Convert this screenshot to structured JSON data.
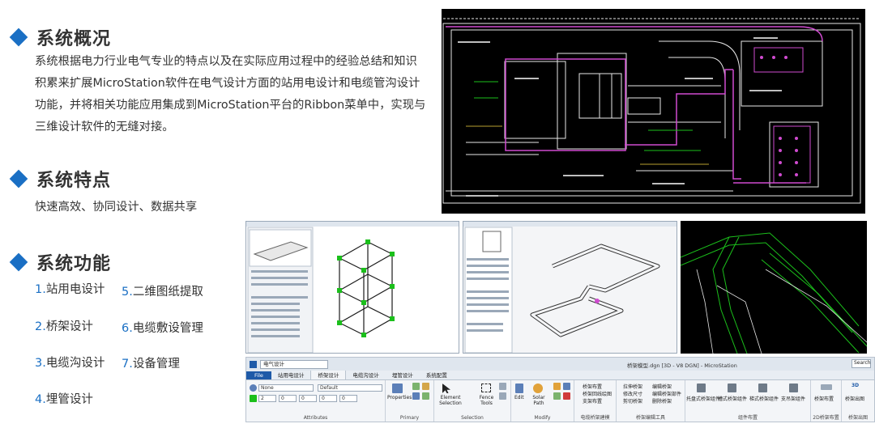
{
  "sections": {
    "overview": {
      "title": "系统概况",
      "lines": [
        "系统根据电力行业电气专业的特点以及在实际应用过程中的经验总结和知识",
        "积累来扩展MicroStation软件在电气设计方面的站用电设计和电缆管沟设计",
        "功能，并将相关功能应用集成到MicroStation平台的Ribbon菜单中，实现与",
        "三维设计软件的无缝对接。"
      ]
    },
    "features": {
      "title": "系统特点",
      "text": "快速高效、协同设计、数据共享"
    },
    "functions": {
      "title": "系统功能",
      "items": [
        {
          "num": "1.",
          "label": "站用电设计"
        },
        {
          "num": "5.",
          "label": "二维图纸提取"
        },
        {
          "num": "2.",
          "label": "桥架设计"
        },
        {
          "num": "6.",
          "label": "电缆敷设管理"
        },
        {
          "num": "3.",
          "label": "电缆沟设计"
        },
        {
          "num": "7.",
          "label": "设备管理"
        },
        {
          "num": "4.",
          "label": "埋管设计"
        }
      ]
    }
  },
  "colors": {
    "accent": "#1a6fc4",
    "cad_background": "#000000",
    "cad_lines": "#ffffff",
    "cad_highlight": "#d04bd0",
    "model_green": "#1bbf1b"
  },
  "ribbon": {
    "workspace": "电气设计",
    "document_title": "桥架模型.dgn [3D - V8 DGN] - MicroStation",
    "search_placeholder": "Search",
    "tabs": [
      "File",
      "站用电设计",
      "桥架设计",
      "电缆沟设计",
      "埋管设计",
      "系统配置"
    ],
    "active_tab": "桥架设计",
    "attributes": {
      "label": "Attributes",
      "level": "None",
      "style": "Default",
      "color": "2",
      "weight": "0",
      "weight2": "0",
      "line": "0",
      "trans": "0"
    },
    "primary": {
      "label": "Primary",
      "properties": "Properties"
    },
    "selection": {
      "label": "Selection",
      "element_selection": "Element Selection",
      "fence": "Fence Tools"
    },
    "modify": {
      "label": "Modify",
      "edit": "Edit",
      "solar": "Solar Path"
    },
    "cable_group": {
      "label": "电缆桥架建模",
      "items": [
        "桥架布置",
        "桥架回线绘图",
        "支架布置"
      ]
    },
    "tray_edit": {
      "label": "桥架编辑工具",
      "items": [
        "拉伸桥架",
        "修改尺寸",
        "剪切桥架",
        "编辑桥架",
        "编辑桥架部件",
        "删除桥架"
      ]
    },
    "component": {
      "label": "组件布置",
      "items": [
        "托盘式桥架组件",
        "槽式桥架组件",
        "梯式桥架组件",
        "支吊架组件"
      ]
    },
    "layout2d": {
      "label": "2D桥架布置",
      "item": "桥架布置"
    },
    "output": {
      "label": "桥架出图",
      "item": "桥架出图",
      "badge": "3D"
    }
  }
}
